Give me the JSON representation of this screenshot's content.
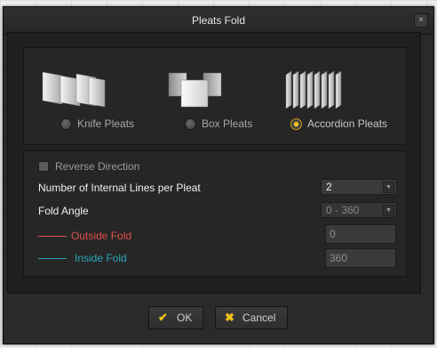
{
  "dialog": {
    "title": "Pleats Fold",
    "close_glyph": "×"
  },
  "pleat_types": [
    {
      "label": "Knife Pleats",
      "icon": "knife-pleats-icon",
      "selected": false
    },
    {
      "label": "Box Pleats",
      "icon": "box-pleats-icon",
      "selected": false
    },
    {
      "label": "Accordion Pleats",
      "icon": "accordion-pleats-icon",
      "selected": true
    }
  ],
  "options": {
    "reverse_direction_label": "Reverse Direction",
    "reverse_direction_checked": false,
    "internal_lines_label": "Number of Internal Lines per Pleat",
    "internal_lines_value": "2",
    "fold_angle_label": "Fold Angle",
    "fold_angle_value": "0 - 360",
    "outside_fold_label": "Outside Fold",
    "outside_fold_value": "0",
    "outside_fold_color": "#e0504c",
    "inside_fold_label": "Inside Fold",
    "inside_fold_value": "360",
    "inside_fold_color": "#2aa5b7"
  },
  "buttons": {
    "ok_label": "OK",
    "ok_icon": "check-icon",
    "cancel_label": "Cancel",
    "cancel_icon": "x-icon",
    "accent": "#f2c21b"
  }
}
